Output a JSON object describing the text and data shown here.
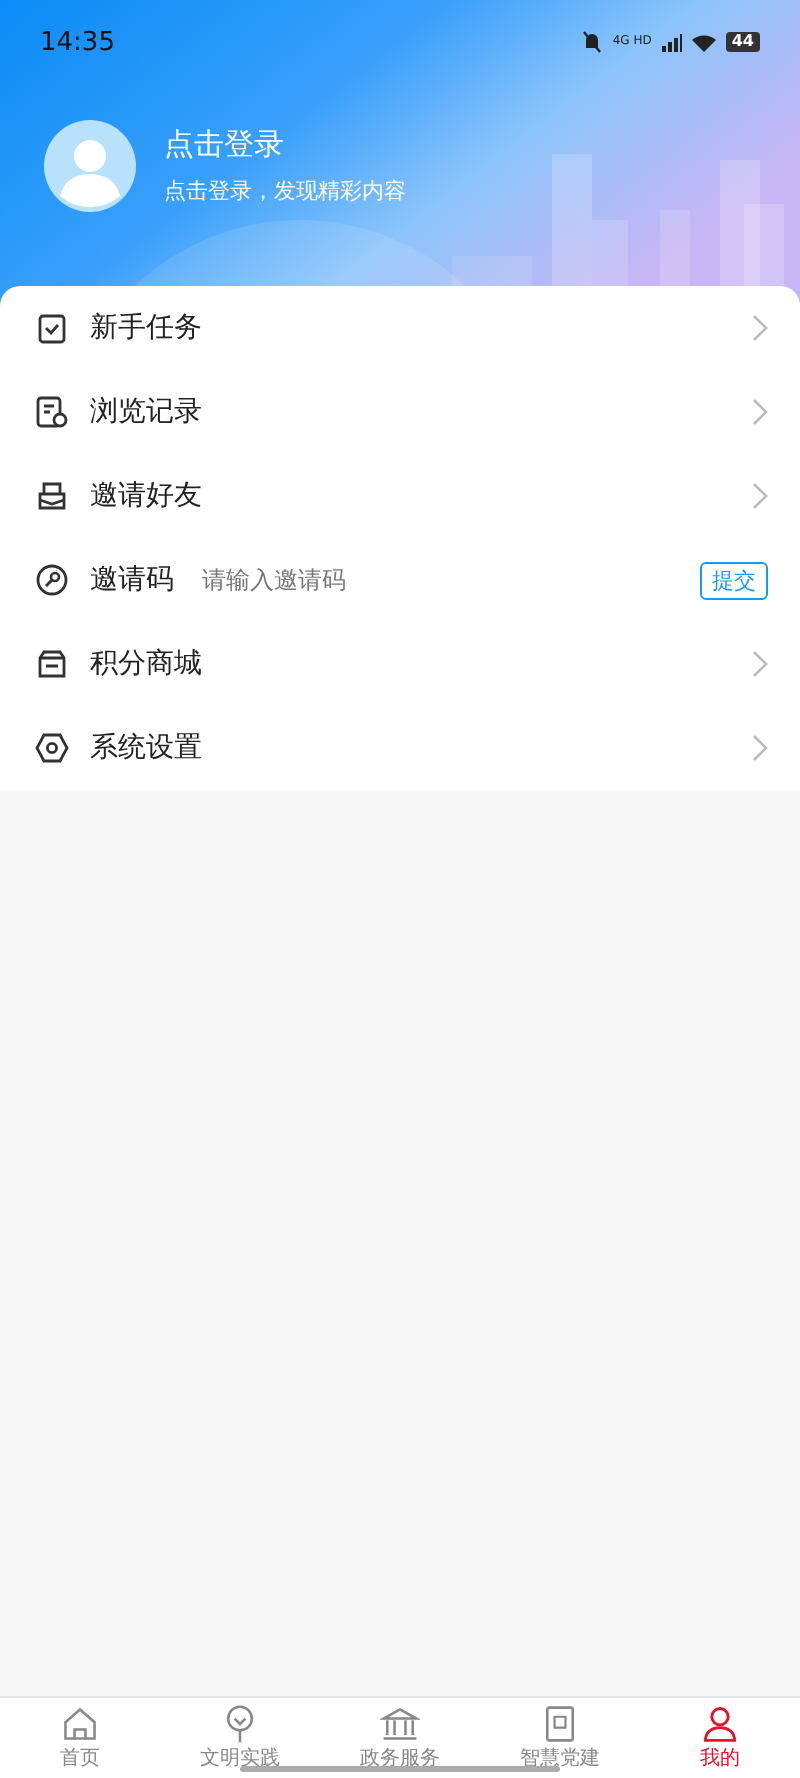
{
  "status_bar": {
    "time": "14:35",
    "network": "4G HD",
    "battery": "44"
  },
  "profile": {
    "title": "点击登录",
    "subtitle": "点击登录，发现精彩内容"
  },
  "menu": [
    {
      "kind": "link",
      "label": "新手任务"
    },
    {
      "kind": "link",
      "label": "浏览记录"
    },
    {
      "kind": "link",
      "label": "邀请好友"
    },
    {
      "kind": "code",
      "label": "邀请码",
      "placeholder": "请输入邀请码",
      "button": "提交"
    },
    {
      "kind": "link",
      "label": "积分商城"
    },
    {
      "kind": "link",
      "label": "系统设置"
    }
  ],
  "tabs": [
    {
      "label": "首页",
      "selected": false
    },
    {
      "label": "文明实践",
      "selected": false
    },
    {
      "label": "政务服务",
      "selected": false
    },
    {
      "label": "智慧党建",
      "selected": false
    },
    {
      "label": "我的",
      "selected": true
    }
  ]
}
